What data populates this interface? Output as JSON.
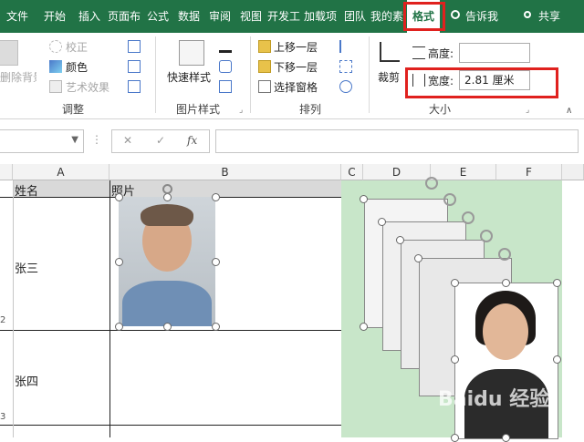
{
  "tabs": [
    "文件",
    "开始",
    "插入",
    "页面布",
    "公式",
    "数据",
    "审阅",
    "视图",
    "开发工",
    "加载项",
    "团队",
    "我的素",
    "格式"
  ],
  "tell_me": "告诉我",
  "share": "共享",
  "ribbon": {
    "remove_bg": "删除背景",
    "correct": "校正",
    "color": "颜色",
    "art_effects": "艺术效果",
    "adjust_group": "调整",
    "quick_styles": "快速样式",
    "picture_styles_group": "图片样式",
    "bring_forward": "上移一层",
    "send_backward": "下移一层",
    "selection_pane": "选择窗格",
    "arrange_group": "排列",
    "crop": "裁剪",
    "height_label": "高度:",
    "height_value": "",
    "width_label": "宽度:",
    "width_value": "2.81 厘米",
    "size_group": "大小"
  },
  "formula": {
    "fx": "fx",
    "cancel": "✕",
    "enter": "✓"
  },
  "columns": [
    "A",
    "B",
    "C",
    "D",
    "E",
    "F"
  ],
  "rows": {
    "header": {
      "a": "姓名",
      "b": "照片"
    },
    "r2": {
      "a": "张三",
      "num": "2"
    },
    "r3": {
      "a": "张四",
      "num": "3"
    }
  },
  "watermark": "Baidu 经验",
  "colors": {
    "excel_green": "#217346",
    "highlight_red": "#e0211e",
    "pane_green": "#c8e6c9"
  }
}
